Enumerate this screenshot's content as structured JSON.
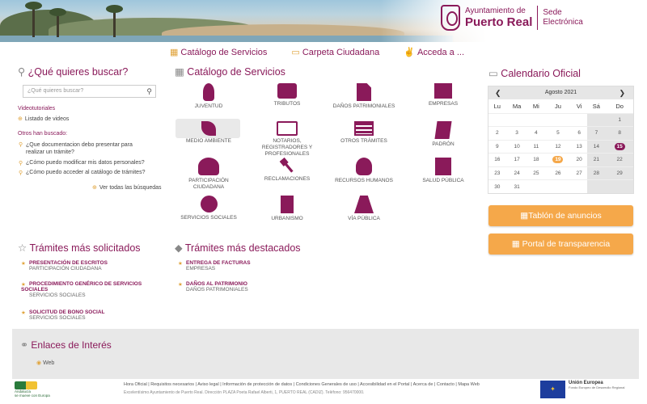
{
  "header": {
    "org_line1": "Ayuntamiento de",
    "org_line2": "Puerto Real",
    "sede_line1": "Sede",
    "sede_line2": "Electrónica"
  },
  "topnav": [
    {
      "label": "Catálogo de Servicios",
      "icon": "grid-icon"
    },
    {
      "label": "Carpeta Ciudadana",
      "icon": "folder-icon"
    },
    {
      "label": "Acceda a ...",
      "icon": "thumbs-up-icon"
    }
  ],
  "search": {
    "title": "¿Qué quieres buscar?",
    "placeholder": "¿Qué quieres buscar?",
    "videotutoriales": "Videotutoriales",
    "listado": "Listado de videos",
    "otros": "Otros han buscado:",
    "q1a": "¿Que documentacion debo presentar para",
    "q1b": "realizar un trámite?",
    "q2": "¿Cómo puedo modificar mis datos personales?",
    "q3": "¿Cómo puedo acceder al catálogo de trámites?",
    "ver_todas": "Ver todas las búsquedas"
  },
  "catalogo": {
    "title": "Catálogo de Servicios",
    "items": [
      {
        "label": "JUVENTUD",
        "icon": "person-icon"
      },
      {
        "label": "TRIBUTOS",
        "icon": "briefcase-icon"
      },
      {
        "label": "DAÑOS PATRIMONIALES",
        "icon": "document-icon"
      },
      {
        "label": "EMPRESAS",
        "icon": "box-icon"
      },
      {
        "label": "MEDIO AMBIENTE",
        "icon": "leaf-icon"
      },
      {
        "label": "NOTARIOS, REGISTRADORES Y PROFESIONALES",
        "icon": "folder-open-icon"
      },
      {
        "label": "OTROS TRÁMITES",
        "icon": "list-icon"
      },
      {
        "label": "PADRÓN",
        "icon": "book-icon"
      },
      {
        "label": "PARTICIPACIÓN CIUDADANA",
        "icon": "users-icon"
      },
      {
        "label": "RECLAMACIONES",
        "icon": "gavel-icon"
      },
      {
        "label": "RECURSOS HUMANOS",
        "icon": "user-icon"
      },
      {
        "label": "SALUD PÚBLICA",
        "icon": "hospital-icon"
      },
      {
        "label": "SERVICIOS SOCIALES",
        "icon": "heart-icon"
      },
      {
        "label": "URBANISMO",
        "icon": "building-icon"
      },
      {
        "label": "VÍA PÚBLICA",
        "icon": "road-icon"
      }
    ]
  },
  "calendar": {
    "title": "Calendario Oficial",
    "month": "Agosto 2021",
    "days": [
      "Lu",
      "Ma",
      "Mi",
      "Ju",
      "Vi",
      "Sá",
      "Do"
    ],
    "weeks": [
      [
        "",
        "",
        "",
        "",
        "",
        "",
        "1"
      ],
      [
        "2",
        "3",
        "4",
        "5",
        "6",
        "7",
        "8"
      ],
      [
        "9",
        "10",
        "11",
        "12",
        "13",
        "14",
        "15"
      ],
      [
        "16",
        "17",
        "18",
        "19",
        "20",
        "21",
        "22"
      ],
      [
        "23",
        "24",
        "25",
        "26",
        "27",
        "28",
        "29"
      ],
      [
        "30",
        "31",
        "",
        "",
        "",
        "",
        ""
      ]
    ],
    "today": "19",
    "highlighted": "15",
    "today_color": "#f5a84a",
    "highlight_color": "#8a1a5a"
  },
  "buttons": {
    "tablon": "Tablón de anuncios",
    "portal": "Portal de transparencia"
  },
  "tramites_solicitados": {
    "title": "Trámites más solicitados",
    "items": [
      {
        "title": "PRESENTACIÓN DE ESCRITOS",
        "sub": "PARTICIPACIÓN CIUDADANA"
      },
      {
        "title": "PROCEDIMIENTO GENÉRICO DE SERVICIOS",
        "title2": "SOCIALES",
        "sub": "SERVICIOS SOCIALES"
      },
      {
        "title": "SOLICITUD DE BONO SOCIAL",
        "sub": "SERVICIOS SOCIALES"
      }
    ]
  },
  "tramites_destacados": {
    "title": "Trámites más destacados",
    "items": [
      {
        "title": "ENTREGA DE FACTURAS",
        "sub": "EMPRESAS"
      },
      {
        "title": "DAÑOS AL PATRIMONIO",
        "sub": "DAÑOS PATRIMONIALES"
      }
    ]
  },
  "enlaces": {
    "title": "Enlaces de Interés",
    "items": [
      "Web"
    ]
  },
  "footer": {
    "links": "Hora Oficial | Requisitos necesarios | Aviso legal | Información de protección de datos | Condiciones Generales de uso | Accesibilidad en el Portal | Acerca de | Contacto | Mapa Web",
    "address": "Excelentísimo Ayuntamiento de Puerto Real. Dirección PLAZA Poeta Rafael Alberti, 1, PUERTO REAL (CADIZ). Teléfono: 956470000.",
    "andalucia1": "Andalucía",
    "andalucia2": "se mueve con Europa",
    "ue_title": "Unión Europea",
    "ue_sub": "Fondo Europeo de Desarrollo Regional"
  },
  "colors": {
    "brand": "#8a1a5a",
    "accent": "#f5a84a"
  }
}
